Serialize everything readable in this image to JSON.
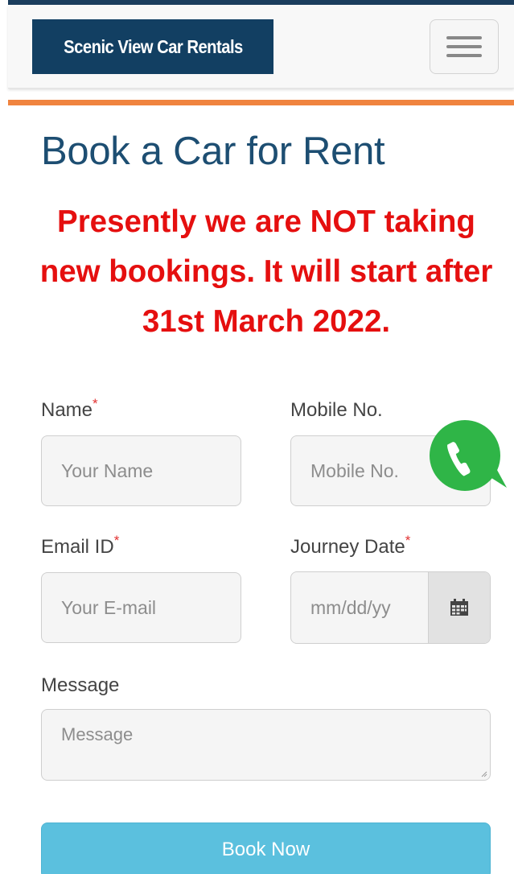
{
  "brand": {
    "name": "Scenic View Car Rentals",
    "bg_color": "#123f62",
    "accent_color": "#f0843f"
  },
  "navbar": {
    "menu_icon": "hamburger-menu-icon"
  },
  "page": {
    "title": "Book a Car for Rent",
    "notice": "Presently we are NOT taking new bookings. It will start after 31st March 2022.",
    "notice_color": "#e50f0f"
  },
  "form": {
    "required_mark": "*",
    "name": {
      "label": "Name",
      "placeholder": "Your Name",
      "required": true
    },
    "mobile": {
      "label": "Mobile No.",
      "placeholder": "Mobile No.",
      "required": false
    },
    "email": {
      "label": "Email ID",
      "placeholder": "Your E-mail",
      "required": true
    },
    "journey_date": {
      "label": "Journey Date",
      "placeholder": "mm/dd/yy",
      "required": true,
      "icon": "calendar-icon"
    },
    "message": {
      "label": "Message",
      "placeholder": "Message"
    },
    "submit_label": "Book Now",
    "submit_color": "#5bc0de"
  },
  "whatsapp": {
    "icon": "whatsapp-icon",
    "color": "#2fb547"
  }
}
